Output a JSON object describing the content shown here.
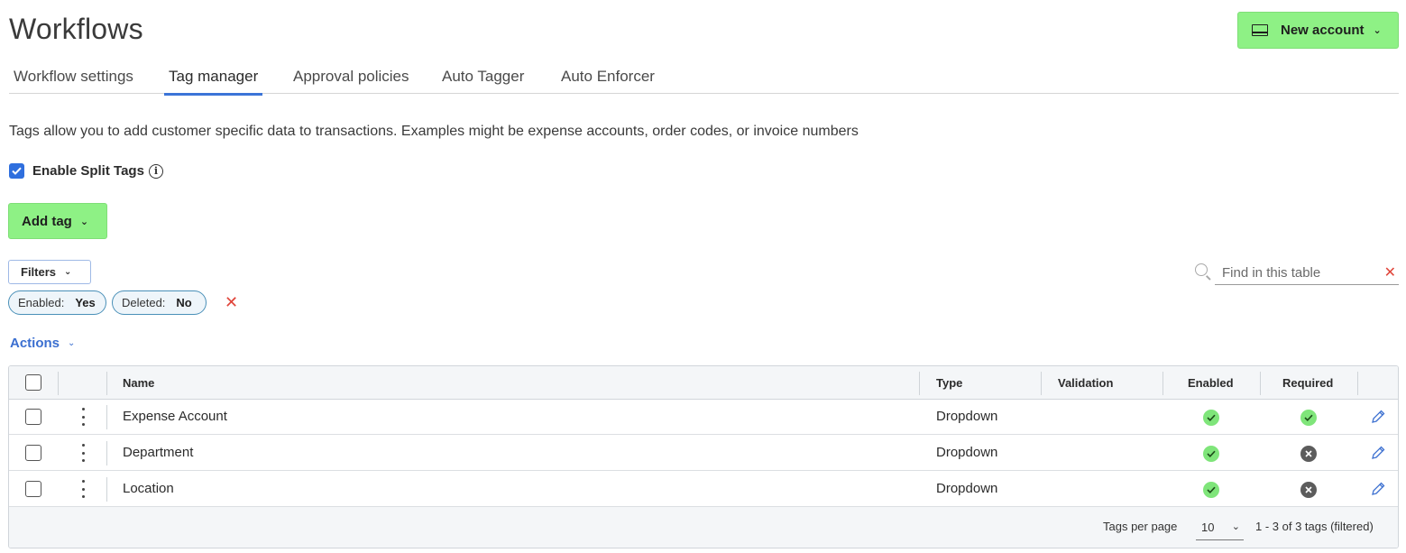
{
  "page": {
    "title": "Workflows"
  },
  "header": {
    "new_account_label": "New account"
  },
  "tabs": [
    {
      "label": "Workflow settings",
      "active": false
    },
    {
      "label": "Tag manager",
      "active": true
    },
    {
      "label": "Approval policies",
      "active": false
    },
    {
      "label": "Auto Tagger",
      "active": false
    },
    {
      "label": "Auto Enforcer",
      "active": false
    }
  ],
  "description": "Tags allow you to add customer specific data to transactions. Examples might be expense accounts, order codes, or invoice numbers",
  "split_tags": {
    "label": "Enable Split Tags",
    "checked": true
  },
  "add_tag_label": "Add tag",
  "filters": {
    "label": "Filters",
    "chips": [
      {
        "key": "Enabled:",
        "value": "Yes"
      },
      {
        "key": "Deleted:",
        "value": "No"
      }
    ]
  },
  "search": {
    "placeholder": "Find in this table",
    "value": ""
  },
  "actions_label": "Actions",
  "table": {
    "columns": [
      "Name",
      "Type",
      "Validation",
      "Enabled",
      "Required"
    ],
    "rows": [
      {
        "name": "Expense Account",
        "type": "Dropdown",
        "validation": "",
        "enabled": true,
        "required": true
      },
      {
        "name": "Department",
        "type": "Dropdown",
        "validation": "",
        "enabled": true,
        "required": false
      },
      {
        "name": "Location",
        "type": "Dropdown",
        "validation": "",
        "enabled": true,
        "required": false
      }
    ]
  },
  "pagination": {
    "per_page_label": "Tags per page",
    "per_page_value": "10",
    "range_text": "1 - 3 of 3 tags (filtered)"
  },
  "colors": {
    "accent_green": "#8ef185",
    "link_blue": "#3b6fd0",
    "tab_underline": "#3b74d8",
    "clear_red": "#e0453a",
    "check_green": "#7fe57a",
    "cross_gray": "#5c5c5c"
  }
}
